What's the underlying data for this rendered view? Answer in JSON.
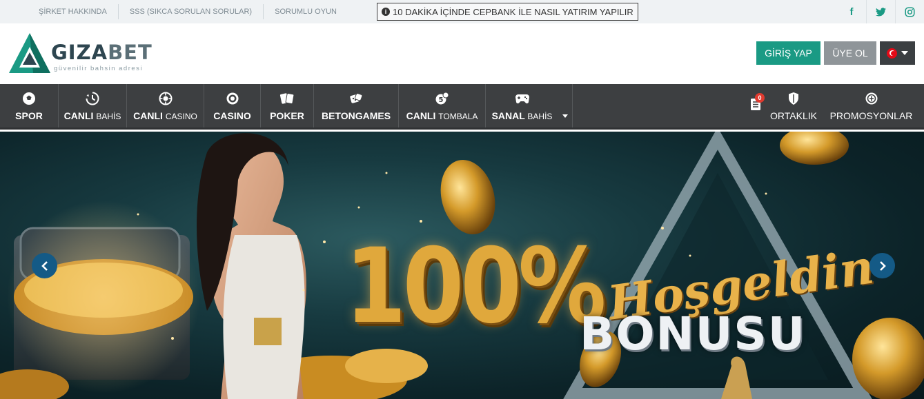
{
  "topbar": {
    "links": [
      "ŞİRKET HAKKINDA",
      "SSS (SIKCA SORULAN SORULAR)",
      "SORUMLU OYUN"
    ],
    "notice": "10 DAKİKA İÇİNDE CEPBANK İLE NASIL YATIRIM YAPILIR",
    "social_icons": [
      "facebook-icon",
      "twitter-icon",
      "instagram-icon"
    ],
    "social_glyphs": [
      "f",
      "t",
      "◎"
    ]
  },
  "header": {
    "logo_word_1": "GIZA",
    "logo_word_2": "BET",
    "logo_tagline": "güvenilir bahsin adresi",
    "login_label": "GİRİŞ YAP",
    "register_label": "ÜYE OL",
    "language_icon": "turkey-flag-icon"
  },
  "nav": {
    "items": [
      {
        "label": "SPOR",
        "sub": "",
        "icon": "soccer-ball-icon"
      },
      {
        "label": "CANLI",
        "sub": "BAHİS",
        "icon": "clock-icon"
      },
      {
        "label": "CANLI",
        "sub": "CASINO",
        "icon": "roulette-icon"
      },
      {
        "label": "CASINO",
        "sub": "",
        "icon": "chip-icon"
      },
      {
        "label": "POKER",
        "sub": "",
        "icon": "cards-icon"
      },
      {
        "label": "BETONGAMES",
        "sub": "",
        "icon": "dice-icon"
      },
      {
        "label": "CANLI",
        "sub": "TOMBALA",
        "icon": "bingo-ball-icon"
      },
      {
        "label": "SANAL",
        "sub": "BAHİS",
        "icon": "gamepad-icon"
      }
    ],
    "betslip_count": "0",
    "right_items": [
      {
        "label": "ORTAKLIK",
        "icon": "shield-icon"
      },
      {
        "label": "PROMOSYONLAR",
        "icon": "gift-icon"
      }
    ]
  },
  "banner": {
    "headline": "100%",
    "script_text": "Hoşgeldin",
    "bonus_text": "BONUSU"
  },
  "colors": {
    "accent": "#1a9a84",
    "nav_bg": "#3d3f41",
    "register_bg": "#8f9599",
    "arrow_bg": "#145a86",
    "gold": "#e0a83c"
  }
}
